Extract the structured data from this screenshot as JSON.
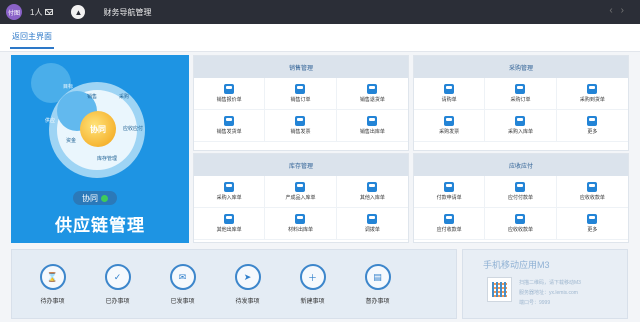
{
  "topbar": {
    "avatar_text": "付图",
    "user_label": "1人",
    "app_title": "财务导航管理",
    "nav_prev": "‹",
    "nav_next": "›"
  },
  "subbar": {
    "back_tab": "返回主界面"
  },
  "hero": {
    "core_label": "协同",
    "wheel_labels": [
      "目标",
      "供应",
      "应收应付",
      "库存管理",
      "资金",
      "销售",
      "采购"
    ],
    "pill_label": "协同",
    "title": "供应链管理"
  },
  "panels": [
    {
      "title": "销售管理",
      "items": [
        "销售报价单",
        "销售订单",
        "销售退货单",
        "销售发货单",
        "销售发票",
        "销售出库单"
      ]
    },
    {
      "title": "采购管理",
      "items": [
        "请购单",
        "采购订单",
        "采购到货单",
        "采购发票",
        "采购入库单",
        "更多"
      ]
    },
    {
      "title": "库存管理",
      "items": [
        "采购入库单",
        "产成品入库单",
        "其他入库单",
        "其他出库单",
        "材料出库单",
        "调拨单"
      ]
    },
    {
      "title": "应收应付",
      "items": [
        "付款申请单",
        "应付付款单",
        "应收收款单",
        "应付收款单",
        "应收收款单",
        "更多"
      ]
    }
  ],
  "tasks": [
    {
      "label": "待办事项",
      "icon": "⌛"
    },
    {
      "label": "已办事项",
      "icon": "✓"
    },
    {
      "label": "已发事项",
      "icon": "✉"
    },
    {
      "label": "待发事项",
      "icon": "➤"
    },
    {
      "label": "新建事项",
      "icon": "＋"
    },
    {
      "label": "督办事项",
      "icon": "▤"
    }
  ],
  "mobile": {
    "title": "手机移动应用M3",
    "line1": "扫描二维码，请下载移动M3",
    "line2": "服务器地址：yx.lemis.com",
    "line3": "端口号：9999"
  }
}
